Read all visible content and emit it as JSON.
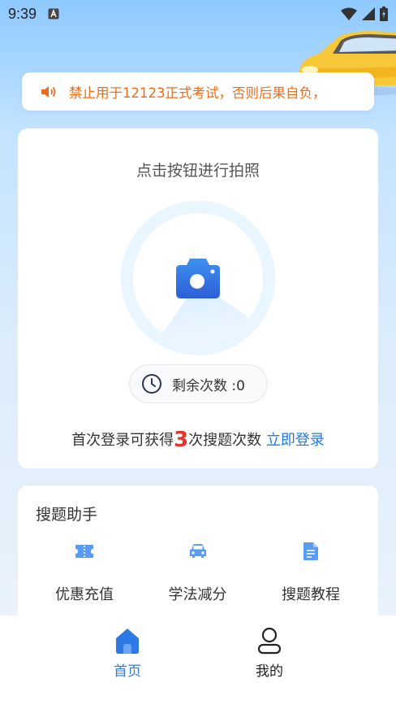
{
  "status_bar": {
    "time": "9:39",
    "notification_icon": "font-a-icon",
    "icons": [
      "wifi-icon",
      "signal-icon",
      "battery-icon"
    ]
  },
  "notice": {
    "icon": "speaker-icon",
    "text": "禁止用于12123正式考试，否则后果自负，",
    "color": "#ef6c1a"
  },
  "photo_card": {
    "title": "点击按钮进行拍照",
    "camera_icon": "camera-icon",
    "remaining": {
      "icon": "clock-icon",
      "label": "剩余次数 :0"
    },
    "login_prompt": {
      "prefix": "首次登录可获得",
      "count": "3",
      "suffix": "次搜题次数 ",
      "link": "立即登录"
    }
  },
  "assistant": {
    "title": "搜题助手",
    "items": [
      {
        "label": "优惠充值",
        "icon": "ticket-icon"
      },
      {
        "label": "学法减分",
        "icon": "car-icon"
      },
      {
        "label": "搜题教程",
        "icon": "document-icon"
      }
    ]
  },
  "tabbar": {
    "tabs": [
      {
        "label": "首页",
        "icon": "home-icon",
        "active": true
      },
      {
        "label": "我的",
        "icon": "user-icon",
        "active": false
      }
    ],
    "accent": "#2d7ae6"
  }
}
